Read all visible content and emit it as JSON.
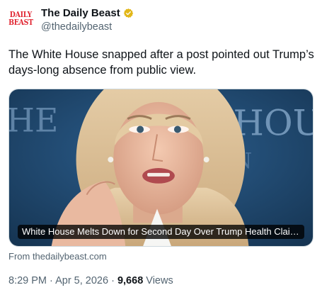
{
  "author": {
    "avatar_line1": "DAILY",
    "avatar_line2": "BEAST",
    "display_name": "The Daily Beast",
    "handle": "@thedailybeast",
    "verified_color": "#e2b719"
  },
  "tweet": {
    "text": "The White House snapped after a post pointed out Trump’s days-long absence from public view."
  },
  "card": {
    "image_icon": "press-briefing-photo",
    "backdrop_text_left": "HE",
    "backdrop_text_right": "HOU",
    "backdrop_text_mid": "ION",
    "title": "White House Melts Down for Second Day Over Trump Health Claims",
    "source": "From thedailybeast.com"
  },
  "meta": {
    "time": "8:29 PM",
    "separator": " · ",
    "date": "Apr 5, 2026",
    "views_count": "9,668",
    "views_label": "Views"
  }
}
